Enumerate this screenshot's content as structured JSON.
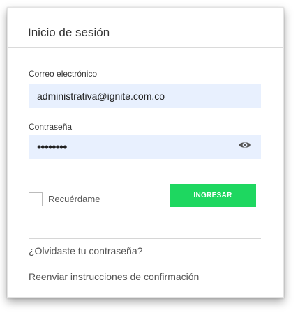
{
  "header": {
    "title": "Inicio de sesión"
  },
  "form": {
    "email_label": "Correo electrónico",
    "email_value": "administrativa@ignite.com.co",
    "password_label": "Contraseña",
    "password_value": "••••••••",
    "remember_label": "Recuérdame",
    "submit_label": "INGRESAR"
  },
  "links": {
    "forgot": "¿Olvidaste tu contraseña?",
    "resend": "Reenviar instrucciones de confirmación"
  },
  "icons": {
    "show_password": "eye-icon"
  },
  "colors": {
    "submit": "#1ed760",
    "autofill": "#e8f0fe"
  }
}
